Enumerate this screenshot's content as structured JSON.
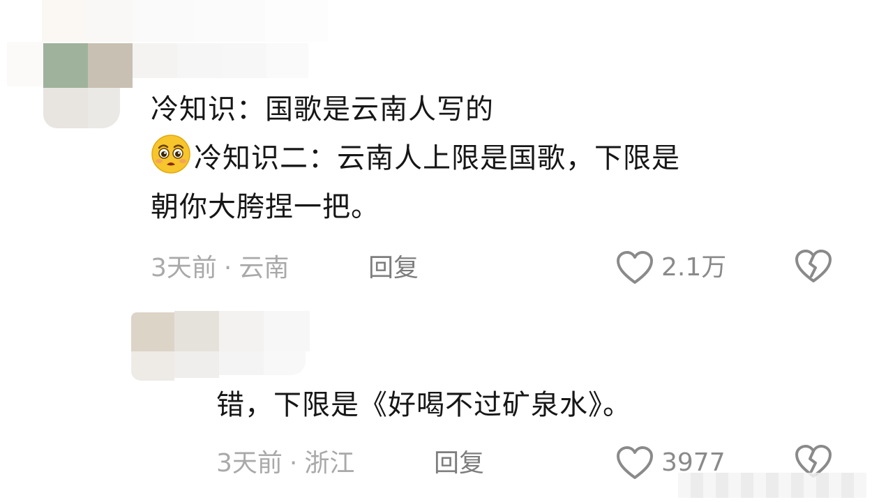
{
  "comment1": {
    "line1": "冷知识：国歌是云南人写的",
    "emoji": "pleading-face-emoji",
    "line2": "冷知识二：云南人上限是国歌，下限是",
    "line3": "朝你大胯捏一把。",
    "time_loc": "3天前",
    "location": "云南",
    "reply_label": "回复",
    "like_count": "2.1万"
  },
  "comment2": {
    "text": "错，下限是《好喝不过矿泉水》。",
    "time_loc": "3天前",
    "location": "浙江",
    "reply_label": "回复",
    "like_count": "3977"
  },
  "colors": {
    "text": "#161616",
    "meta": "#a9a9a9",
    "reply": "#7d7d7d",
    "icon": "#8a8a8a"
  }
}
